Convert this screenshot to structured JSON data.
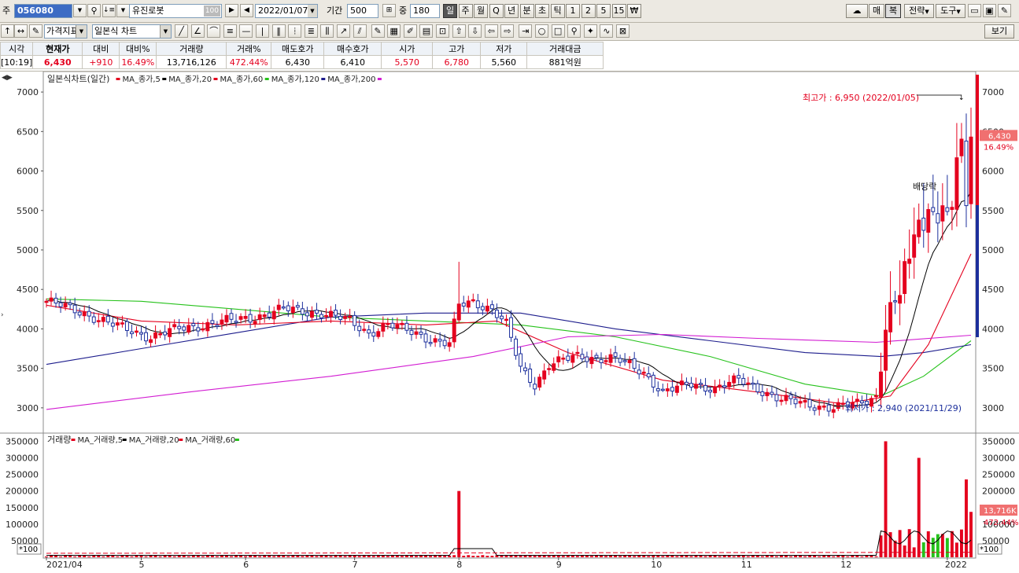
{
  "toolbar1": {
    "market_label": "주",
    "stock_code": "056080",
    "stock_name": "유진로봇",
    "name_badge": "100",
    "date": "2022/01/07",
    "period_label": "기간",
    "period_value": "500",
    "mid_label": "중",
    "mid_value": "180",
    "interval_buttons": [
      "일",
      "주",
      "월",
      "Q",
      "년",
      "분",
      "초",
      "틱",
      "1",
      "2",
      "5",
      "15",
      "₩"
    ],
    "interval_selected": "일",
    "right_buttons": [
      "매",
      "복",
      "전략",
      "도구"
    ]
  },
  "toolbar2": {
    "indicator_dropdown": "가격지표",
    "chart_type_dropdown": "일본식 차트",
    "view_button": "보기"
  },
  "quote": {
    "headers": [
      "시각",
      "현재가",
      "대비",
      "대비%",
      "거래량",
      "거래%",
      "매도호가",
      "매수호가",
      "시가",
      "고가",
      "저가",
      "거래대금"
    ],
    "values": [
      "[10:19]",
      "6,430",
      "+910",
      "16.49%",
      "13,716,126",
      "472.44%",
      "6,430",
      "6,410",
      "5,570",
      "6,780",
      "5,560",
      "881억원"
    ],
    "red_columns": [
      1,
      2,
      3,
      5,
      8,
      9
    ]
  },
  "price_panel": {
    "legend_title": "일본식차트(일간)",
    "ma_legend": [
      {
        "label": "MA_종가,5",
        "color": "#e4001e"
      },
      {
        "label": "MA_종가,20",
        "color": "#000000"
      },
      {
        "label": "MA_종가,60",
        "color": "#e4001e"
      },
      {
        "label": "MA_종가,120",
        "color": "#26c21b"
      },
      {
        "label": "MA_종가,200",
        "color": "#1c1c8c"
      }
    ],
    "extra_legend_color": "#d21cd2",
    "y_ticks": [
      7000,
      6500,
      6000,
      5500,
      5000,
      4500,
      4000,
      3500,
      3000
    ],
    "ymin": 2700,
    "ymax": 7200,
    "high_annotation": "최고가 : 6,950 (2022/01/05)",
    "low_annotation": "최저가 : 2,940 (2021/11/29)",
    "dividend_label": "배당락",
    "current_price_label": "6,430",
    "current_change_label": "16.49%",
    "current_price": 6430
  },
  "volume_panel": {
    "legend_title": "거래량",
    "ma_legend": [
      {
        "label": "MA_거래량,5",
        "color": "#e4001e"
      },
      {
        "label": "MA_거래량,20",
        "color": "#000000"
      },
      {
        "label": "MA_거래량,60",
        "color": "#e4001e"
      }
    ],
    "extra_legend_color": "#26c21b",
    "y_ticks": [
      350000,
      300000,
      250000,
      200000,
      150000,
      100000,
      50000
    ],
    "ymax": 370000,
    "unit_label": "*100",
    "current_volume_label": "13,716K",
    "current_volume_pct": "472.44%"
  },
  "x_axis": {
    "labels": [
      {
        "text": "2021/04",
        "idx": 0
      },
      {
        "text": "5",
        "idx": 20
      },
      {
        "text": "6",
        "idx": 42
      },
      {
        "text": "7",
        "idx": 65
      },
      {
        "text": "8",
        "idx": 87
      },
      {
        "text": "9",
        "idx": 108
      },
      {
        "text": "10",
        "idx": 128
      },
      {
        "text": "11",
        "idx": 147
      },
      {
        "text": "12",
        "idx": 168
      },
      {
        "text": "2022",
        "idx": 190
      }
    ]
  },
  "chart_data": {
    "type": "candlestick",
    "bars": 196,
    "anchors": [
      [
        0,
        4350
      ],
      [
        8,
        4200
      ],
      [
        14,
        4050
      ],
      [
        22,
        3900
      ],
      [
        28,
        4000
      ],
      [
        36,
        4080
      ],
      [
        44,
        4150
      ],
      [
        50,
        4250
      ],
      [
        58,
        4200
      ],
      [
        64,
        4100
      ],
      [
        68,
        3950
      ],
      [
        72,
        4050
      ],
      [
        78,
        3950
      ],
      [
        82,
        3850
      ],
      [
        85,
        3800
      ],
      [
        87,
        4300
      ],
      [
        90,
        4350
      ],
      [
        94,
        4250
      ],
      [
        97,
        4050
      ],
      [
        100,
        3500
      ],
      [
        103,
        3300
      ],
      [
        106,
        3550
      ],
      [
        112,
        3650
      ],
      [
        120,
        3620
      ],
      [
        126,
        3450
      ],
      [
        130,
        3200
      ],
      [
        136,
        3300
      ],
      [
        141,
        3250
      ],
      [
        146,
        3350
      ],
      [
        150,
        3250
      ],
      [
        155,
        3100
      ],
      [
        160,
        3050
      ],
      [
        166,
        3000
      ],
      [
        171,
        3050
      ],
      [
        175,
        3150
      ],
      [
        176,
        3400
      ],
      [
        177,
        4100
      ],
      [
        180,
        4500
      ],
      [
        183,
        5200
      ],
      [
        186,
        5450
      ],
      [
        189,
        5450
      ],
      [
        191,
        5600
      ],
      [
        193,
        6500
      ],
      [
        194,
        5550
      ],
      [
        195,
        6430
      ]
    ],
    "ma_series": [
      {
        "name": "MA_종가,120",
        "color": "#26c21b",
        "points": [
          [
            0,
            4380
          ],
          [
            20,
            4350
          ],
          [
            40,
            4250
          ],
          [
            60,
            4150
          ],
          [
            80,
            4100
          ],
          [
            100,
            4050
          ],
          [
            120,
            3900
          ],
          [
            140,
            3650
          ],
          [
            160,
            3300
          ],
          [
            176,
            3150
          ],
          [
            185,
            3400
          ],
          [
            195,
            3850
          ]
        ]
      },
      {
        "name": "MA_종가,200",
        "color": "#1c1c8c",
        "points": [
          [
            0,
            3550
          ],
          [
            20,
            3750
          ],
          [
            40,
            3950
          ],
          [
            60,
            4150
          ],
          [
            80,
            4200
          ],
          [
            100,
            4200
          ],
          [
            120,
            4000
          ],
          [
            140,
            3850
          ],
          [
            160,
            3700
          ],
          [
            176,
            3650
          ],
          [
            185,
            3700
          ],
          [
            195,
            3800
          ]
        ]
      },
      {
        "name": "MA_종가,60",
        "color": "#e4001e",
        "points": [
          [
            0,
            4300
          ],
          [
            20,
            4100
          ],
          [
            40,
            4050
          ],
          [
            60,
            4100
          ],
          [
            80,
            4050
          ],
          [
            95,
            4100
          ],
          [
            110,
            3700
          ],
          [
            130,
            3350
          ],
          [
            150,
            3200
          ],
          [
            168,
            3050
          ],
          [
            178,
            3150
          ],
          [
            186,
            3800
          ],
          [
            195,
            4950
          ]
        ]
      },
      {
        "name": "magenta",
        "color": "#d21cd2",
        "points": [
          [
            0,
            2980
          ],
          [
            30,
            3200
          ],
          [
            60,
            3400
          ],
          [
            90,
            3650
          ],
          [
            110,
            3900
          ],
          [
            130,
            3930
          ],
          [
            150,
            3880
          ],
          [
            175,
            3830
          ],
          [
            195,
            3920
          ]
        ]
      }
    ],
    "volume_spikes": [
      [
        87,
        200000
      ],
      [
        177,
        350000
      ],
      [
        184,
        300000
      ],
      [
        194,
        235000
      ],
      [
        196,
        137000
      ]
    ]
  }
}
